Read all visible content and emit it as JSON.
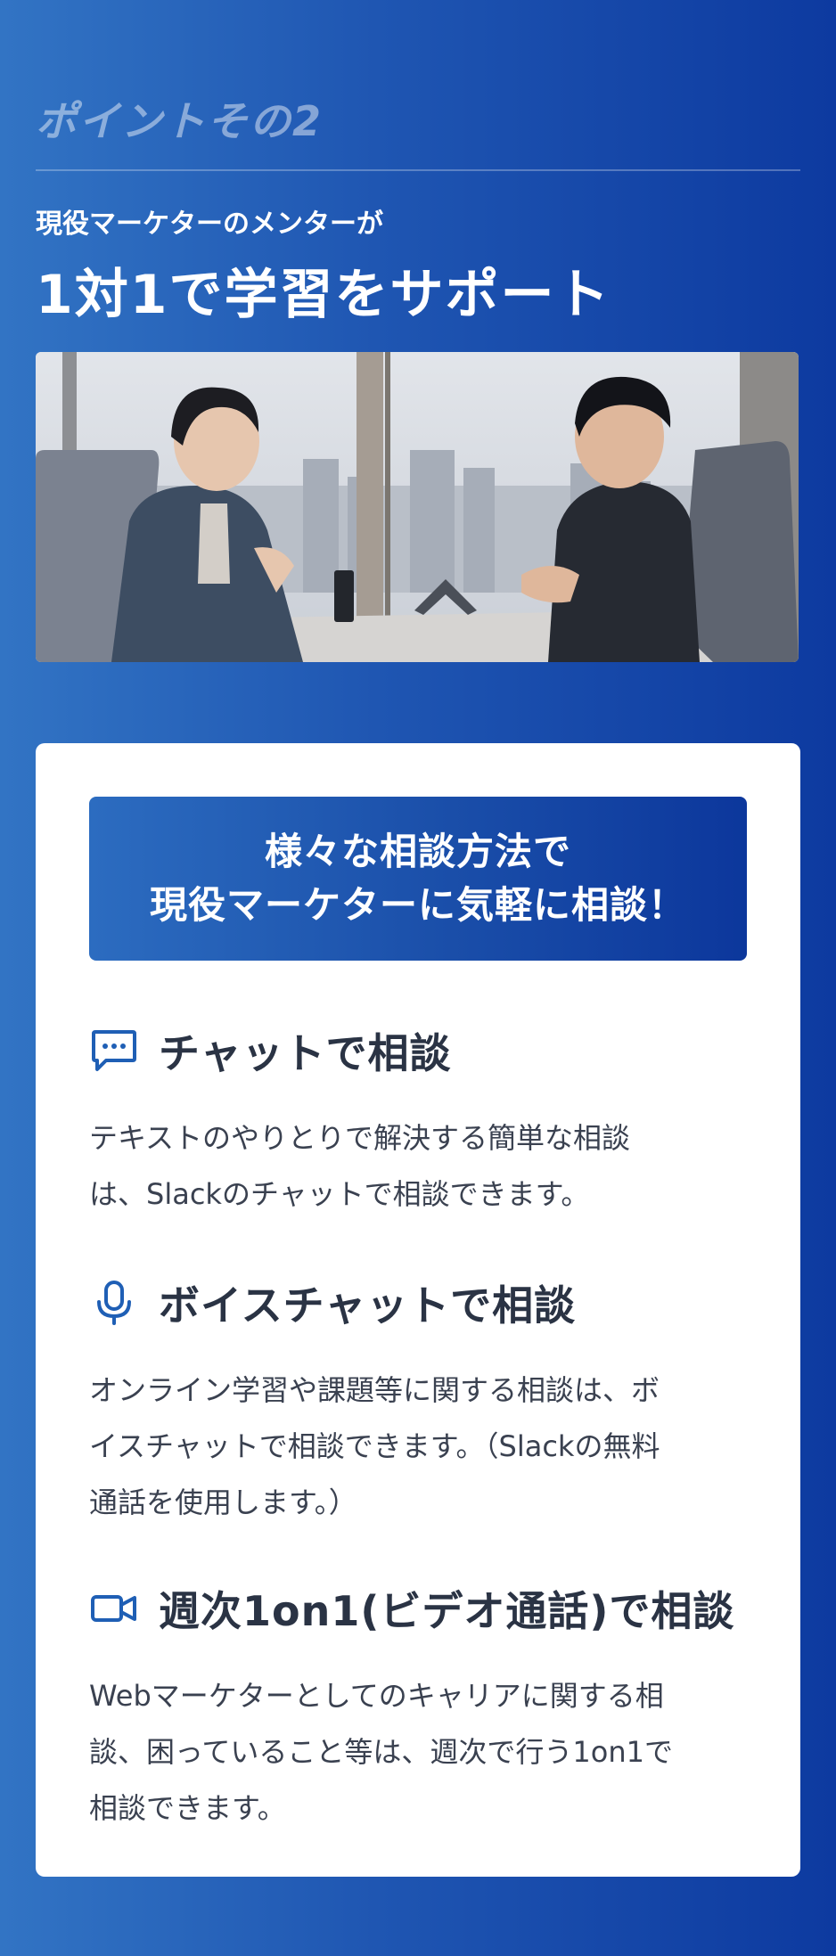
{
  "header": {
    "point_label": "ポイントその2",
    "subtitle": "現役マーケターのメンターが",
    "title": "1対1で学習をサポート"
  },
  "card": {
    "banner_lines": [
      "様々な相談方法で",
      "現役マーケターに気軽に相談！"
    ],
    "methods": [
      {
        "icon": "chat-bubble-icon",
        "title": "チャットで相談",
        "desc_lines": [
          "テキストのやりとりで解決する簡単な相談",
          "は、Slackのチャットで相談できます。"
        ]
      },
      {
        "icon": "microphone-icon",
        "title": "ボイスチャットで相談",
        "desc_lines": [
          "オンライン学習や課題等に関する相談は、ボ",
          "イスチャットで相談できます。（Slackの無料",
          "通話を使用します。）"
        ]
      },
      {
        "icon": "video-camera-icon",
        "title": "週次1on1(ビデオ通話)で相談",
        "desc_lines": [
          "Webマーケターとしてのキャリアに関する相",
          "談、困っていること等は、週次で行う1on1で",
          "相談できます。"
        ]
      }
    ]
  },
  "colors": {
    "icon_blue": "#1f5fb5",
    "heading_dark": "#2a3344"
  }
}
